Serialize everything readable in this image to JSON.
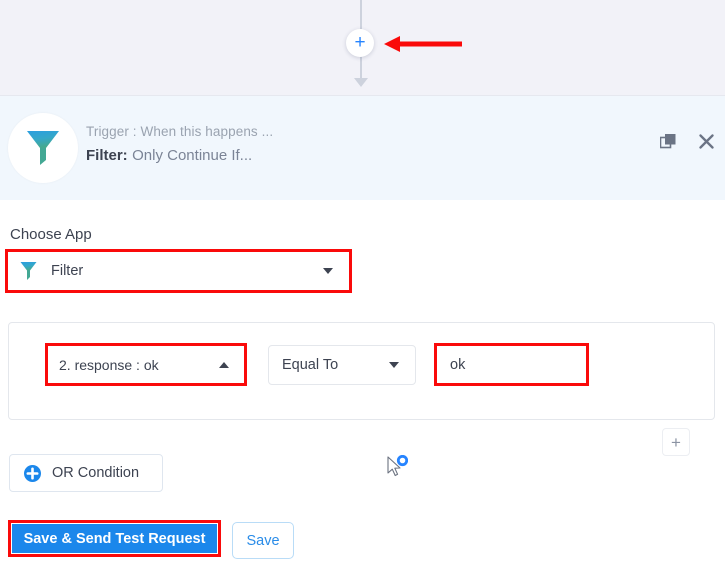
{
  "canvas": {
    "add_step_glyph": "+",
    "annotation_arrow_color": "#fa0a0a",
    "connector_color": "#cdd2dd"
  },
  "step_header": {
    "trigger_label": "Trigger : When this happens ...",
    "name_prefix": "Filter:",
    "name_value": "Only Continue If...",
    "app_icon": "filter-funnel-icon",
    "actions": [
      {
        "name": "duplicate-icon",
        "glyph": "duplicate"
      },
      {
        "name": "close-icon",
        "glyph": "✕"
      }
    ],
    "background": "#f1f7fd"
  },
  "choose_app": {
    "label": "Choose App",
    "selected_value": "Filter",
    "icon": "filter-funnel-icon",
    "caret": "chevron-down",
    "highlighted": true
  },
  "condition": {
    "lhs": {
      "value": "2. response : ok",
      "caret": "chevron-up",
      "highlighted": true
    },
    "operator": {
      "value": "Equal To",
      "caret": "chevron-down"
    },
    "rhs": {
      "value": "ok",
      "placeholder": "",
      "highlighted": true
    },
    "add_button_glyph": "+"
  },
  "or_condition": {
    "label": "OR Condition",
    "icon": "circle-plus-icon"
  },
  "footer": {
    "primary_label": "Save & Send Test Request",
    "primary_color": "#1b87eb",
    "primary_highlighted": true,
    "secondary_label": "Save",
    "secondary_color": "#2a8ce8"
  }
}
